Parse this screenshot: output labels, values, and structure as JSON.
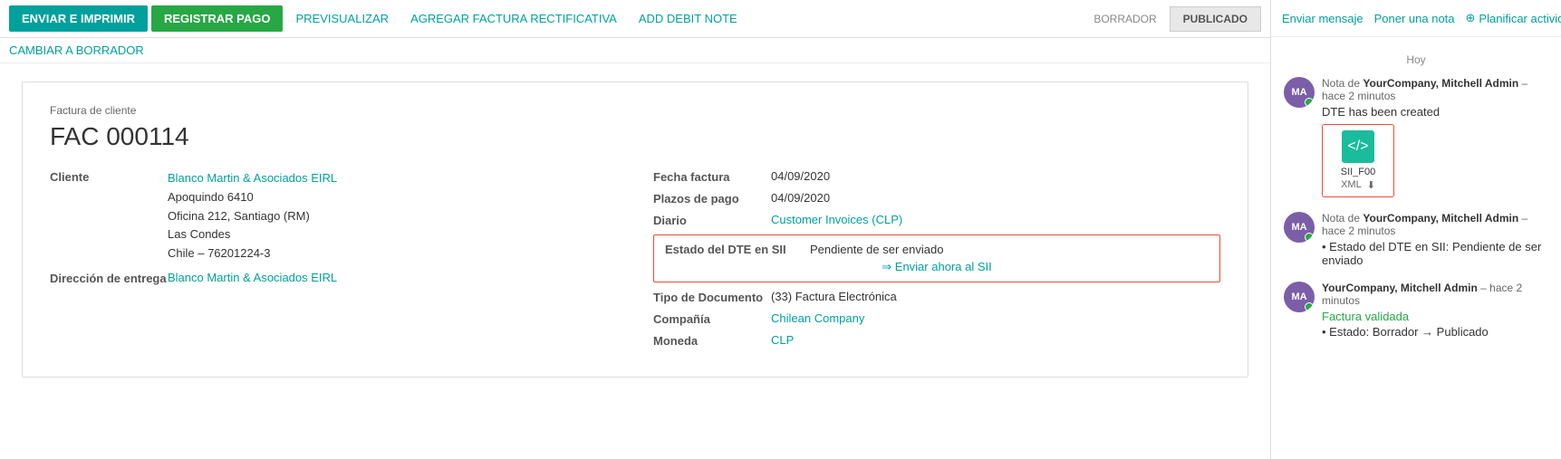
{
  "toolbar": {
    "btn_enviar": "ENVIAR E IMPRIMIR",
    "btn_registrar": "REGISTRAR PAGO",
    "btn_previsualizar": "PREVISUALIZAR",
    "btn_agregar": "AGREGAR FACTURA RECTIFICATIVA",
    "btn_debit": "ADD DEBIT NOTE",
    "status_draft_label": "BORRADOR",
    "status_published": "PUBLICADO",
    "btn_cambiar": "CAMBIAR A BORRADOR"
  },
  "document": {
    "type_label": "Factura de cliente",
    "number": "FAC 000114",
    "cliente_label": "Cliente",
    "cliente_name": "Blanco Martin & Asociados EIRL",
    "cliente_address1": "Apoquindo 6410",
    "cliente_address2": "Oficina 212, Santiago (RM)",
    "cliente_address3": "Las Condes",
    "cliente_address4": "Chile – 76201224-3",
    "entrega_label": "Dirección de entrega",
    "entrega_value": "Blanco Martin & Asociados EIRL",
    "fecha_label": "Fecha factura",
    "fecha_value": "04/09/2020",
    "plazos_label": "Plazos de pago",
    "plazos_value": "04/09/2020",
    "diario_label": "Diario",
    "diario_value": "Customer Invoices (CLP)",
    "dte_label": "Estado del DTE en SII",
    "dte_status": "Pendiente de ser enviado",
    "dte_action": "⇒ Enviar ahora al SII",
    "tipo_label": "Tipo de Documento",
    "tipo_value": "(33) Factura Electrónica",
    "compania_label": "Compañía",
    "compania_value": "Chilean Company",
    "moneda_label": "Moneda",
    "moneda_value": "CLP"
  },
  "chatter": {
    "btn_enviar": "Enviar mensaje",
    "btn_nota": "Poner una nota",
    "btn_planificar": "Planificar actividad",
    "today_label": "Hoy",
    "msg1": {
      "author": "YourCompany, Mitchell Admin",
      "time": "hace 2 minutos",
      "note_prefix": "Nota de ",
      "content": "DTE has been created",
      "attachment_name": "SII_F00",
      "attachment_ext": "XML"
    },
    "msg2": {
      "author": "YourCompany, Mitchell Admin",
      "time": "hace 2 minutos",
      "note_prefix": "Nota de ",
      "bullet": "Estado del DTE en SII: Pendiente de ser enviado"
    },
    "msg3": {
      "author": "YourCompany, Mitchell Admin",
      "time": "hace 2 minutos",
      "validated": "Factura validada",
      "bullet": "Estado: Borrador → Publicado"
    }
  }
}
